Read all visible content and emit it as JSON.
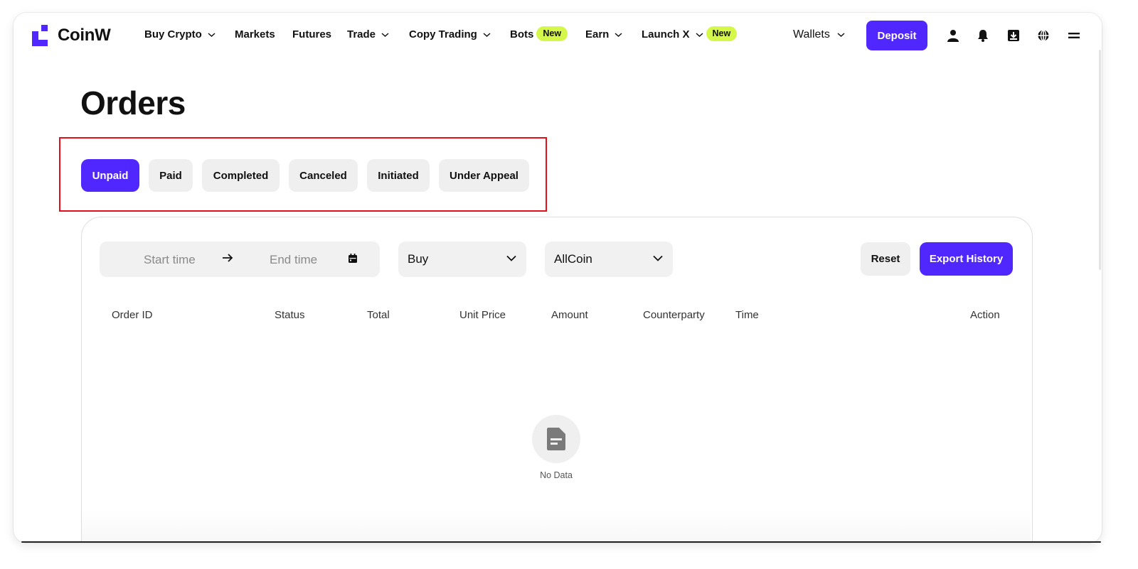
{
  "brand": {
    "name": "CoinW",
    "accent": "#5127ff",
    "badge_color": "#d4f74a",
    "highlight_color": "#e3101a"
  },
  "nav": {
    "items": [
      {
        "label": "Buy Crypto",
        "dropdown": true
      },
      {
        "label": "Markets",
        "dropdown": false
      },
      {
        "label": "Futures",
        "dropdown": false
      },
      {
        "label": "Trade",
        "dropdown": true
      },
      {
        "label": "Copy Trading",
        "dropdown": true
      },
      {
        "label": "Bots",
        "dropdown": false,
        "badge": "New"
      },
      {
        "label": "Earn",
        "dropdown": true
      },
      {
        "label": "Launch X",
        "dropdown": true,
        "badge": "New"
      }
    ],
    "wallets_label": "Wallets",
    "deposit_label": "Deposit",
    "icons": [
      "user-icon",
      "bell-icon",
      "download-icon",
      "globe-icon",
      "menu-icon"
    ]
  },
  "page": {
    "title": "Orders",
    "tabs": [
      {
        "label": "Unpaid",
        "active": true
      },
      {
        "label": "Paid",
        "active": false
      },
      {
        "label": "Completed",
        "active": false
      },
      {
        "label": "Canceled",
        "active": false
      },
      {
        "label": "Initiated",
        "active": false
      },
      {
        "label": "Under Appeal",
        "active": false
      }
    ]
  },
  "filters": {
    "start_placeholder": "Start time",
    "end_placeholder": "End time",
    "side_value": "Buy",
    "coin_value": "AllCoin",
    "reset_label": "Reset",
    "export_label": "Export History"
  },
  "table": {
    "columns": [
      "Order ID",
      "Status",
      "Total",
      "Unit Price",
      "Amount",
      "Counterparty",
      "Time",
      "Action"
    ],
    "rows": [],
    "empty_text": "No Data"
  }
}
